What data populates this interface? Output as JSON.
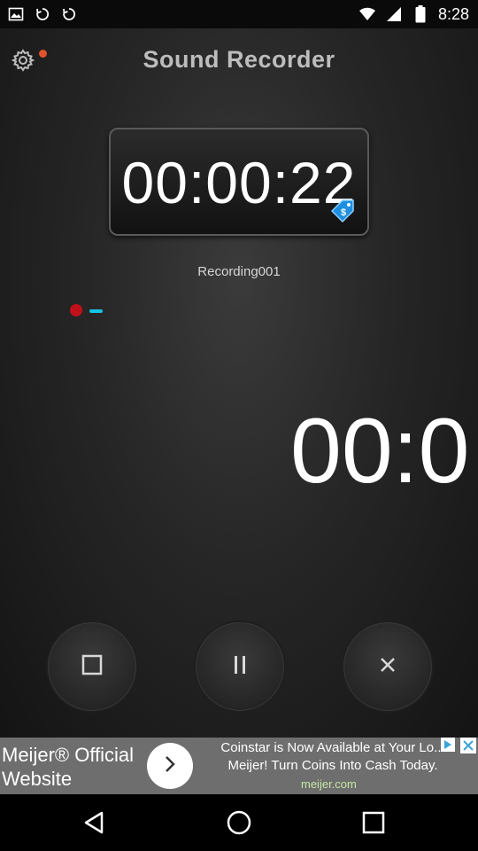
{
  "status_bar": {
    "time": "8:28",
    "icons": [
      "picture-icon",
      "sync-icon",
      "sync-icon"
    ]
  },
  "app": {
    "title": "Sound Recorder",
    "timer": "00:00:22",
    "recording_name": "Recording001",
    "big_timer": "00:0"
  },
  "controls": {
    "stop": "stop-icon",
    "pause": "pause-icon",
    "cancel": "close-icon"
  },
  "ad": {
    "left_text": "Meijer® Official Website",
    "message": "Coinstar is Now Available at Your Lo... Meijer! Turn Coins Into Cash Today.",
    "domain": "meijer.com"
  },
  "colors": {
    "record_red": "#c0111b",
    "level_cyan": "#14c4e4",
    "notify_orange": "#e0532a"
  }
}
